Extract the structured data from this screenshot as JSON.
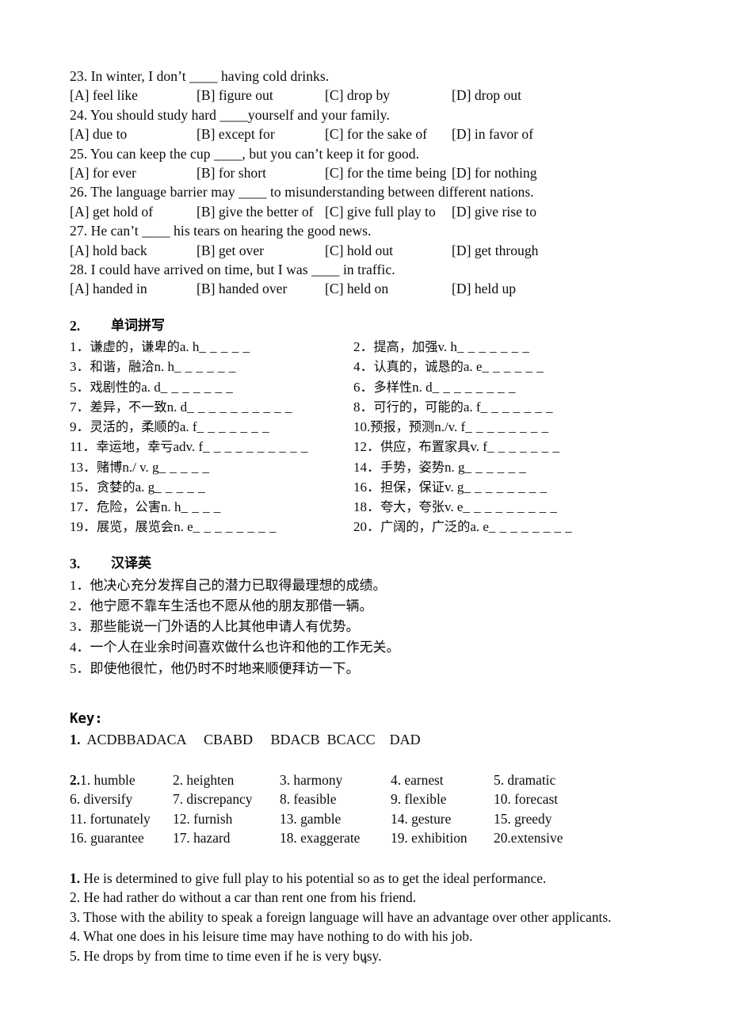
{
  "document": {
    "page_number": "4",
    "language": "mixed-zh-en"
  },
  "section1": {
    "questions": [
      {
        "stem": "23. In winter, I don’t ____ having cold drinks.",
        "options": [
          "[A] feel like",
          "[B] figure out",
          "[C] drop by",
          "[D] drop out"
        ]
      },
      {
        "stem": "24. You should study hard ____yourself and your family.",
        "options": [
          "[A] due to",
          "[B] except for",
          "[C] for the sake of",
          "[D] in favor of"
        ]
      },
      {
        "stem": "25. You can keep the cup ____, but you can’t keep it for good.",
        "options": [
          "[A] for ever",
          "[B] for short",
          "[C] for the time being",
          "[D] for nothing"
        ]
      },
      {
        "stem": "26. The language barrier may ____ to misunderstanding between different nations.",
        "options": [
          "[A] get hold of",
          "[B] give the better of",
          "[C] give full play to",
          "[D] give rise to"
        ]
      },
      {
        "stem": "27. He can’t ____ his tears on hearing the good news.",
        "options": [
          "[A] hold back",
          "[B] get over",
          "[C] hold out",
          "[D] get through"
        ]
      },
      {
        "stem": "28. I could have arrived on time, but I was ____ in traffic.",
        "options": [
          "[A] handed in",
          "[B] handed over",
          "[C] held on",
          "[D] held up"
        ]
      }
    ]
  },
  "section2": {
    "number": "2.",
    "title": "单词拼写",
    "items": [
      {
        "index": "1．",
        "cn": "谦虚的，谦卑的",
        "pos": "a. h",
        "blank": "_ _ _ _ _"
      },
      {
        "index": "2．",
        "cn": "提高，加强",
        "pos": "v. h",
        "blank": "_ _ _ _ _ _ _"
      },
      {
        "index": "3．",
        "cn": "和谐，融洽",
        "pos": "n. h",
        "blank": "_ _ _ _ _ _"
      },
      {
        "index": "4．",
        "cn": "认真的，诚恳的",
        "pos": "a. e",
        "blank": "_ _ _ _ _ _"
      },
      {
        "index": "5．",
        "cn": "戏剧性的",
        "pos": "a. d",
        "blank": "_ _ _ _ _ _ _"
      },
      {
        "index": "6．",
        "cn": "多样性",
        "pos": "n. d",
        "blank": "_ _ _ _ _ _ _ _"
      },
      {
        "index": "7．",
        "cn": "差异，不一致",
        "pos": "n. d",
        "blank": "_ _ _ _ _ _ _ _ _ _"
      },
      {
        "index": "8．",
        "cn": "可行的，可能的",
        "pos": "a. f",
        "blank": "_ _ _ _ _ _ _"
      },
      {
        "index": "9．",
        "cn": "灵活的，柔顺的",
        "pos": "a. f",
        "blank": "_ _ _ _ _ _ _"
      },
      {
        "index": "10.",
        "cn": "预报，预测",
        "pos": "n./v. f",
        "blank": "_ _ _ _ _ _ _ _"
      },
      {
        "index": "11．",
        "cn": "幸运地，幸亏",
        "pos": "adv. f",
        "blank": "_ _ _ _ _ _ _ _ _ _"
      },
      {
        "index": "12．",
        "cn": "供应，布置家具",
        "pos": "v. f",
        "blank": "_ _ _ _ _ _ _"
      },
      {
        "index": "13．",
        "cn": "赌博",
        "pos": "n./ v. g",
        "blank": "_ _ _ _ _"
      },
      {
        "index": "14．",
        "cn": "手势，姿势",
        "pos": "n. g",
        "blank": "_ _ _ _ _ _"
      },
      {
        "index": "15．",
        "cn": "贪婪的",
        "pos": "a. g",
        "blank": "_ _ _ _ _"
      },
      {
        "index": "16．",
        "cn": "担保，保证",
        "pos": "v. g",
        "blank": "_ _ _ _ _ _ _ _"
      },
      {
        "index": "17．",
        "cn": "危险，公害",
        "pos": "n. h",
        "blank": "_ _ _ _"
      },
      {
        "index": "18．",
        "cn": "夸大，夸张",
        "pos": "v. e",
        "blank": "_ _ _ _ _ _ _ _ _"
      },
      {
        "index": "19．",
        "cn": "展览，展览会",
        "pos": "n. e",
        "blank": "_ _ _ _ _ _ _ _"
      },
      {
        "index": "20．",
        "cn": "广阔的，广泛的",
        "pos": "a. e",
        "blank": "_ _ _ _ _ _ _ _"
      }
    ]
  },
  "section3": {
    "number": "3.",
    "title": "汉译英",
    "sentences": [
      {
        "index": "1．",
        "text": "他决心充分发挥自己的潜力已取得最理想的成绩。"
      },
      {
        "index": "2．",
        "text": "他宁愿不靠车生活也不愿从他的朋友那借一辆。"
      },
      {
        "index": "3．",
        "text": "那些能说一门外语的人比其他申请人有优势。"
      },
      {
        "index": "4．",
        "text": "一个人在业余时间喜欢做什么也许和他的工作无关。"
      },
      {
        "index": "5．",
        "text": "即使他很忙，他仍时不时地来顺便拜访一下。"
      }
    ]
  },
  "key": {
    "heading": "Key:",
    "part1": {
      "label": "1.",
      "answers": "  ACDBBADACA     CBABD     BDACB  BCACC    DAD"
    },
    "part2": {
      "label": "2.",
      "rows": [
        [
          "1. humble",
          "2. heighten",
          "3. harmony",
          "4. earnest",
          "5. dramatic"
        ],
        [
          "6. diversify",
          "7. discrepancy",
          "8. feasible",
          "9. flexible",
          "10. forecast"
        ],
        [
          "11. fortunately",
          "12. furnish",
          "13. gamble",
          "14. gesture",
          "15. greedy"
        ],
        [
          "16. guarantee",
          "17. hazard",
          "18. exaggerate",
          "19. exhibition",
          "20.extensive"
        ]
      ]
    },
    "part3": {
      "sentences": [
        {
          "label": "1.",
          "bold_label": true,
          "text": " He is determined to give full play to his potential so as to get the ideal performance."
        },
        {
          "label": "2.",
          "bold_label": false,
          "text": " He had rather do without a car than rent one from his friend."
        },
        {
          "label": "3.",
          "bold_label": false,
          "text": " Those with the ability to speak a foreign language will have an advantage over other applicants."
        },
        {
          "label": "4.",
          "bold_label": false,
          "text": " What one does in his leisure time may have nothing to do with his job."
        },
        {
          "label": "5.",
          "bold_label": false,
          "text": " He drops by from time to time even if he is very busy."
        }
      ]
    }
  }
}
